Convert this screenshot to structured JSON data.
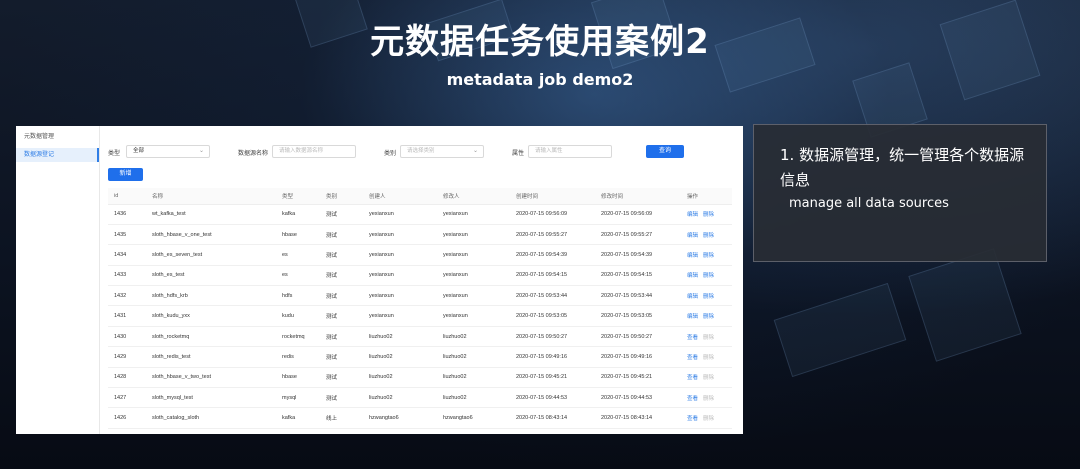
{
  "slide": {
    "title": "元数据任务使用案例2",
    "subtitle": "metadata job demo2"
  },
  "sidebar": {
    "items": [
      {
        "label": "元数据管理",
        "active": false
      },
      {
        "label": "数据源登记",
        "active": true
      }
    ]
  },
  "filters": {
    "type_label": "类型",
    "type_value": "全部",
    "name_label": "数据源名称",
    "name_placeholder": "请输入数据源名称",
    "category_label": "类别",
    "category_placeholder": "请选择类别",
    "attr_label": "属性",
    "attr_placeholder": "请输入属性",
    "query_button": "查询"
  },
  "toolbar": {
    "new_button": "新增"
  },
  "table": {
    "columns": [
      "id",
      "名称",
      "类型",
      "类别",
      "创建人",
      "修改人",
      "创建时间",
      "修改时间",
      "操作"
    ],
    "rows": [
      {
        "id": "1436",
        "name": "wt_kafka_test",
        "type": "kafka",
        "category": "测试",
        "creator": "yexianxun",
        "modifier": "yexianxun",
        "created": "2020-07-15 09:56:09",
        "modified": "2020-07-15 09:56:09",
        "action1": "编辑",
        "action2": "删除"
      },
      {
        "id": "1435",
        "name": "sloth_hbase_v_one_test",
        "type": "hbase",
        "category": "测试",
        "creator": "yexianxun",
        "modifier": "yexianxun",
        "created": "2020-07-15 09:55:27",
        "modified": "2020-07-15 09:55:27",
        "action1": "编辑",
        "action2": "删除"
      },
      {
        "id": "1434",
        "name": "sloth_es_seven_test",
        "type": "es",
        "category": "测试",
        "creator": "yexianxun",
        "modifier": "yexianxun",
        "created": "2020-07-15 09:54:39",
        "modified": "2020-07-15 09:54:39",
        "action1": "编辑",
        "action2": "删除"
      },
      {
        "id": "1433",
        "name": "sloth_es_test",
        "type": "es",
        "category": "测试",
        "creator": "yexianxun",
        "modifier": "yexianxun",
        "created": "2020-07-15 09:54:15",
        "modified": "2020-07-15 09:54:15",
        "action1": "编辑",
        "action2": "删除"
      },
      {
        "id": "1432",
        "name": "sloth_hdfs_krb",
        "type": "hdfs",
        "category": "测试",
        "creator": "yexianxun",
        "modifier": "yexianxun",
        "created": "2020-07-15 09:53:44",
        "modified": "2020-07-15 09:53:44",
        "action1": "编辑",
        "action2": "删除"
      },
      {
        "id": "1431",
        "name": "sloth_kudu_yxx",
        "type": "kudu",
        "category": "测试",
        "creator": "yexianxun",
        "modifier": "yexianxun",
        "created": "2020-07-15 09:53:05",
        "modified": "2020-07-15 09:53:05",
        "action1": "编辑",
        "action2": "删除"
      },
      {
        "id": "1430",
        "name": "sloth_rocketmq",
        "type": "rocketmq",
        "category": "测试",
        "creator": "liuzhuo02",
        "modifier": "liuzhuo02",
        "created": "2020-07-15 09:50:27",
        "modified": "2020-07-15 09:50:27",
        "action1": "查看",
        "action2": "删除"
      },
      {
        "id": "1429",
        "name": "sloth_redis_test",
        "type": "redis",
        "category": "测试",
        "creator": "liuzhuo02",
        "modifier": "liuzhuo02",
        "created": "2020-07-15 09:49:16",
        "modified": "2020-07-15 09:49:16",
        "action1": "查看",
        "action2": "删除"
      },
      {
        "id": "1428",
        "name": "sloth_hbase_v_two_test",
        "type": "hbase",
        "category": "测试",
        "creator": "liuzhuo02",
        "modifier": "liuzhuo02",
        "created": "2020-07-15 09:45:21",
        "modified": "2020-07-15 09:45:21",
        "action1": "查看",
        "action2": "删除"
      },
      {
        "id": "1427",
        "name": "sloth_mysql_test",
        "type": "mysql",
        "category": "测试",
        "creator": "liuzhuo02",
        "modifier": "liuzhuo02",
        "created": "2020-07-15 09:44:53",
        "modified": "2020-07-15 09:44:53",
        "action1": "查看",
        "action2": "删除"
      },
      {
        "id": "1426",
        "name": "sloth_catalog_sloth",
        "type": "kafka",
        "category": "线上",
        "creator": "hzwangtao6",
        "modifier": "hzwangtao6",
        "created": "2020-07-15 08:43:14",
        "modified": "2020-07-15 08:43:14",
        "action1": "查看",
        "action2": "删除"
      }
    ]
  },
  "info": {
    "cn": "1. 数据源管理，统一管理各个数据源信息",
    "en": "manage all data sources"
  },
  "colors": {
    "accent": "#1f6feb",
    "link": "#2f7ee6",
    "disabled_link": "#bbbbbb"
  },
  "icons": {
    "select_arrow": "chevron-down-icon"
  }
}
